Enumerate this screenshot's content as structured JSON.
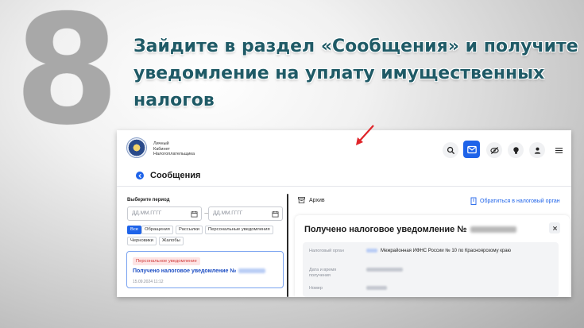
{
  "slide": {
    "step_number": "8",
    "headline_line1": "Зайдите в раздел «Сообщения»  и получите",
    "headline_line2": "уведомление на уплату  имущественных налогов"
  },
  "app": {
    "logo_text": [
      "Личный",
      "Кабинет",
      "Налогоплательщика"
    ],
    "toolbar_icons": [
      "search-icon",
      "messages-icon",
      "visibility-off-icon",
      "lightbulb-icon",
      "user-icon",
      "menu-icon"
    ],
    "accent_color": "#1e63e9",
    "page_title": "Сообщения"
  },
  "filters": {
    "period_label": "Выберите период",
    "date_from_placeholder": "ДД.ММ.ГГГГ",
    "date_to_placeholder": "ДД.ММ.ГГГГ",
    "date_separator": "—",
    "chips": [
      "Все",
      "Обращения",
      "Рассылки",
      "Персональные уведомления",
      "Черновики",
      "Жалобы"
    ],
    "active_chip": "Все"
  },
  "message_card": {
    "badge": "Персональное уведомление",
    "title": "Получено налоговое уведомление №",
    "date": "15.09.2024 11:12"
  },
  "right_panel": {
    "archive_label": "Архив",
    "contact_link": "Обратиться в налоговый орган"
  },
  "notice": {
    "title": "Получено налоговое уведомление №",
    "fields": [
      {
        "label": "Налоговый орган",
        "value": "Межрайонная ИФНС России № 10 по Красноярскому краю"
      },
      {
        "label": "Дата и время получения",
        "value": ""
      },
      {
        "label": "Номер",
        "value": ""
      }
    ]
  }
}
